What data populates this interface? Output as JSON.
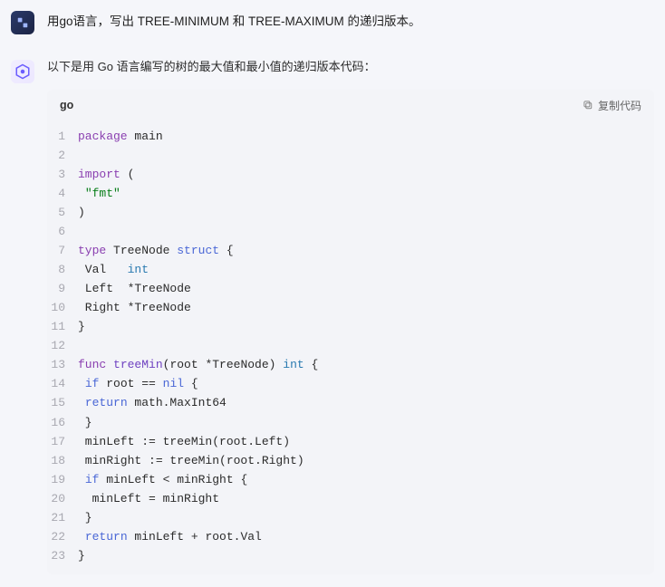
{
  "user": {
    "prompt": "用go语言，写出 TREE-MINIMUM 和 TREE-MAXIMUM 的递归版本。"
  },
  "assistant": {
    "intro": "以下是用 Go 语言编写的树的最大值和最小值的递归版本代码：",
    "code": {
      "language": "go",
      "copy_label": "复制代码",
      "lines": [
        {
          "n": "1",
          "seg": [
            [
              "kw",
              "package"
            ],
            [
              "txt",
              " main"
            ]
          ]
        },
        {
          "n": "2",
          "seg": []
        },
        {
          "n": "3",
          "seg": [
            [
              "kw",
              "import"
            ],
            [
              "txt",
              " ("
            ]
          ]
        },
        {
          "n": "4",
          "seg": [
            [
              "txt",
              " "
            ],
            [
              "str",
              "\"fmt\""
            ]
          ]
        },
        {
          "n": "5",
          "seg": [
            [
              "txt",
              ")"
            ]
          ]
        },
        {
          "n": "6",
          "seg": []
        },
        {
          "n": "7",
          "seg": [
            [
              "kw",
              "type"
            ],
            [
              "txt",
              " TreeNode "
            ],
            [
              "bl",
              "struct"
            ],
            [
              "txt",
              " {"
            ]
          ]
        },
        {
          "n": "8",
          "seg": [
            [
              "txt",
              " Val   "
            ],
            [
              "ty",
              "int"
            ]
          ]
        },
        {
          "n": "9",
          "seg": [
            [
              "txt",
              " Left  *TreeNode"
            ]
          ]
        },
        {
          "n": "10",
          "seg": [
            [
              "txt",
              " Right *TreeNode"
            ]
          ]
        },
        {
          "n": "11",
          "seg": [
            [
              "txt",
              "}"
            ]
          ]
        },
        {
          "n": "12",
          "seg": []
        },
        {
          "n": "13",
          "seg": [
            [
              "kw",
              "func"
            ],
            [
              "txt",
              " "
            ],
            [
              "fn",
              "treeMin"
            ],
            [
              "txt",
              "(root *TreeNode) "
            ],
            [
              "ty",
              "int"
            ],
            [
              "txt",
              " {"
            ]
          ]
        },
        {
          "n": "14",
          "seg": [
            [
              "txt",
              " "
            ],
            [
              "bl",
              "if"
            ],
            [
              "txt",
              " root == "
            ],
            [
              "bl",
              "nil"
            ],
            [
              "txt",
              " {"
            ]
          ]
        },
        {
          "n": "15",
          "seg": [
            [
              "txt",
              " "
            ],
            [
              "bl",
              "return"
            ],
            [
              "txt",
              " math.MaxInt64"
            ]
          ]
        },
        {
          "n": "16",
          "seg": [
            [
              "txt",
              " }"
            ]
          ]
        },
        {
          "n": "17",
          "seg": [
            [
              "txt",
              " minLeft := treeMin(root.Left)"
            ]
          ]
        },
        {
          "n": "18",
          "seg": [
            [
              "txt",
              " minRight := treeMin(root.Right)"
            ]
          ]
        },
        {
          "n": "19",
          "seg": [
            [
              "txt",
              " "
            ],
            [
              "bl",
              "if"
            ],
            [
              "txt",
              " minLeft < minRight {"
            ]
          ]
        },
        {
          "n": "20",
          "seg": [
            [
              "txt",
              "  minLeft = minRight"
            ]
          ]
        },
        {
          "n": "21",
          "seg": [
            [
              "txt",
              " }"
            ]
          ]
        },
        {
          "n": "22",
          "seg": [
            [
              "txt",
              " "
            ],
            [
              "bl",
              "return"
            ],
            [
              "txt",
              " minLeft + root.Val"
            ]
          ]
        },
        {
          "n": "23",
          "seg": [
            [
              "txt",
              "}"
            ]
          ]
        }
      ]
    }
  }
}
